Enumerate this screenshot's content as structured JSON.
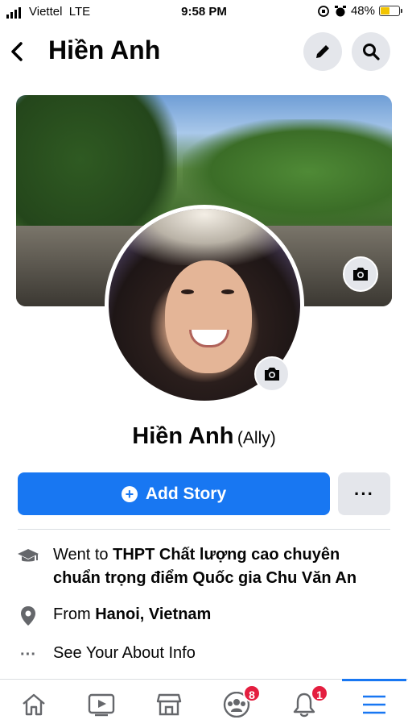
{
  "status_bar": {
    "carrier": "Viettel",
    "network": "LTE",
    "time": "9:58 PM",
    "battery": "48%",
    "battery_level": 0.48,
    "icons": [
      "signal-icon",
      "orientation-lock-icon",
      "alarm-icon",
      "battery-icon"
    ]
  },
  "header": {
    "title": "Hiền Anh",
    "icons": [
      "back-icon",
      "pencil-icon",
      "search-icon"
    ]
  },
  "profile": {
    "name": "Hiền Anh",
    "nickname": "(Ally)"
  },
  "actions": {
    "add_story_label": "Add Story",
    "more_label": "···"
  },
  "info": {
    "education_prefix": "Went to ",
    "education_school_line1": "THPT Chất lượng cao chuyên",
    "education_school_line2": "chuẩn trọng điểm Quốc gia Chu Văn An",
    "from_prefix": "From ",
    "from_place": "Hanoi, Vietnam",
    "about_label": "See Your About Info",
    "about_icon_text": "···"
  },
  "tab_bar": {
    "tabs": [
      {
        "name": "home",
        "icon": "home-icon"
      },
      {
        "name": "watch",
        "icon": "video-icon"
      },
      {
        "name": "marketplace",
        "icon": "marketplace-icon"
      },
      {
        "name": "groups",
        "icon": "groups-icon",
        "badge": "8"
      },
      {
        "name": "notifications",
        "icon": "bell-icon",
        "badge": "1"
      },
      {
        "name": "menu",
        "icon": "menu-icon",
        "active": true
      }
    ]
  },
  "colors": {
    "accent": "#1877f2",
    "badge": "#e41e3f",
    "button_gray": "#e4e6eb",
    "secondary_text": "#65676b"
  }
}
